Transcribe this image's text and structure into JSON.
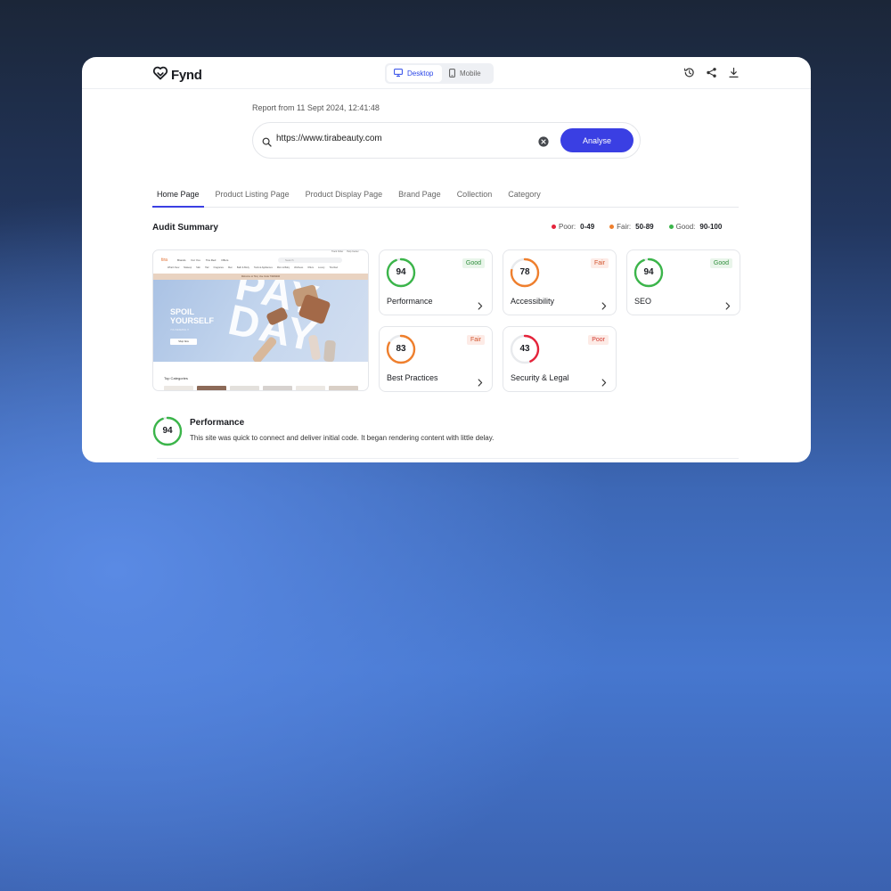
{
  "brand": {
    "name": "Fynd"
  },
  "device_toggle": {
    "desktop": "Desktop",
    "mobile": "Mobile",
    "selected": "Desktop"
  },
  "top_actions": {
    "icons": [
      "history-icon",
      "share-icon",
      "download-icon"
    ]
  },
  "report": {
    "date": "Report from 11 Sept 2024, 12:41:48"
  },
  "search": {
    "value": "https://www.tirabeauty.com",
    "button": "Analyse"
  },
  "tabs": [
    "Home Page",
    "Product Listing Page",
    "Product Display Page",
    "Brand Page",
    "Collection",
    "Category"
  ],
  "active_tab": "Home Page",
  "audit": {
    "title": "Audit Summary",
    "legend": [
      {
        "label": "Poor:",
        "range": "0-49",
        "color": "#e5243b"
      },
      {
        "label": "Fair:",
        "range": "50-89",
        "color": "#ef7f2d"
      },
      {
        "label": "Good:",
        "range": "90-100",
        "color": "#3bb54a"
      }
    ],
    "cards": [
      {
        "score": 94,
        "label": "Performance",
        "status": "Good",
        "color": "#3bb54a"
      },
      {
        "score": 78,
        "label": "Accessibility",
        "status": "Fair",
        "color": "#ef7f2d"
      },
      {
        "score": 94,
        "label": "SEO",
        "status": "Good",
        "color": "#3bb54a"
      },
      {
        "score": 83,
        "label": "Best Practices",
        "status": "Fair",
        "color": "#ef7f2d"
      },
      {
        "score": 43,
        "label": "Security & Legal",
        "status": "Poor",
        "color": "#e5243b"
      }
    ]
  },
  "preview": {
    "logo": "tira",
    "nav": [
      "Brands",
      "For You",
      "Tira Red",
      "Offers"
    ],
    "search_placeholder": "Search",
    "links": [
      "Track Order",
      "Help Center"
    ],
    "menu": [
      "What's New",
      "Makeup",
      "Skin",
      "Hair",
      "Fragrance",
      "Men",
      "Bath & Body",
      "Tools & Appliances",
      "Mom & Baby",
      "Wellness",
      "Offers",
      "Luxury",
      "Tira Red"
    ],
    "strip": "Welcome to Tira | Use Code TIRANEW",
    "hero_heading_1": "SPOIL",
    "hero_heading_2": "YOURSELF",
    "hero_sub": "YOU DESERVE IT",
    "hero_button": "Shop Now",
    "hero_word_1": "PAY",
    "hero_word_2": "DAY",
    "categories_title": "Top Categories"
  },
  "performance_detail": {
    "score": 94,
    "title": "Performance",
    "description": "This site was quick to connect and deliver initial code. It began rendering content with little delay.",
    "color": "#3bb54a"
  }
}
